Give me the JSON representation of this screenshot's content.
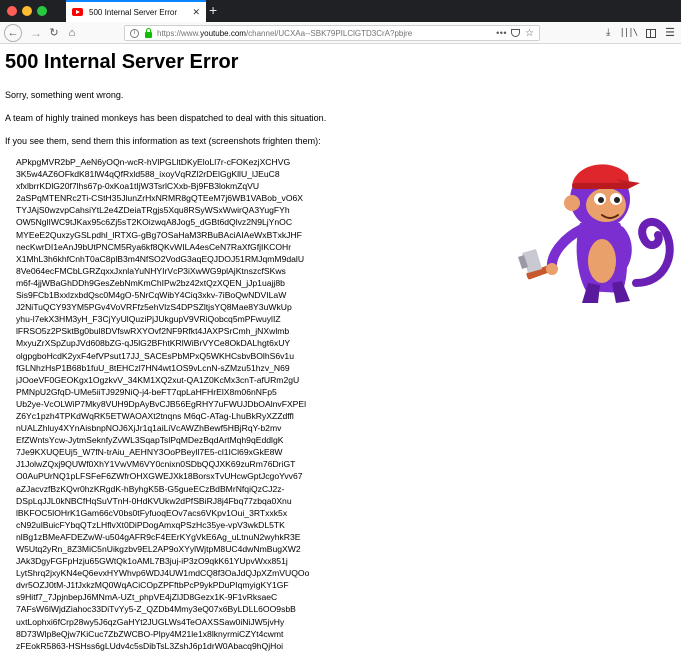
{
  "browser": {
    "tab_title": "500 Internal Server Error",
    "tab_close": "✕",
    "new_tab": "+",
    "url_prefix": "https://www.",
    "url_host": "youtube.com",
    "url_path": "/channel/UCXAa--SBK79PILClGTD3CrA?pbjre",
    "url_more": "•••",
    "icons": {
      "back": "back-arrow-icon",
      "forward": "forward-arrow-icon",
      "reload": "reload-icon",
      "home": "home-icon",
      "info": "info-icon",
      "lock": "lock-icon",
      "pocket": "pocket-icon",
      "star": "bookmark-star-icon",
      "download": "download-icon",
      "library": "library-icon",
      "sidebar": "sidebar-icon",
      "menu": "hamburger-menu-icon"
    },
    "colors": {
      "accent": "#0a84ff",
      "lock": "#12bc00",
      "favicon": "#ff0000"
    }
  },
  "page": {
    "title": "500 Internal Server Error",
    "message_1": "Sorry, something went wrong.",
    "message_2": "A team of highly trained monkeys has been dispatched to deal with this situation.",
    "message_3": "If you see them, send them this information as text (screenshots frighten them):",
    "image": "monkey-with-hammer-illustration",
    "code_lines": [
      "APkpgMVR2bP_AeN6yOQn-wcR-hVlPGLltDKyEloLl7r-cFOKezjXCHVG",
      "3K5w4AZ6OFkdK81lW4qQfRxld588_ixoyVqRZl2rDElGgKllU_lJEuC8",
      "xfxlbrrKDlG20f7lhs67p-0xKoa1tIjW3TsrlCXxb-Bj9FB3lokmZqVU",
      "2aSPqMTENRc2Ti-CStH35JlunZrHxNRMR8gQTEeM7j6WB1VABob_vO6X",
      "TYJAjS0wzvpCahsiYtL2e4ZDeiaTRgjs5Xqu8RSyWSxWwirQA3YugFYh",
      "OW5NglIWC9tJKax95c6Zj5sT2KOizwqA8Jog5_dGBt6dQlvz2N9LjYnOC",
      "MYEeE2QuxzyGSLpdhl_lRTXG-gBg7OSaHaM3RBuBAciAIAeWxBTxkJHF",
      "necKwrDI1eAnJ9bUtPNCM5Rya6kf8QKvWILA4esCeN7RaXfGfjIKCOHr",
      "X1MhL3h6khfCnhT0aC8plB3m4NfSO2VodG3aqEQJDOJ51RMJqmM9dalU",
      "8Ve064ecFMCbLGRZqxxJxnlaYuNHYIrVcP3iXwWG9plAjKtnszcfSKws",
      "m6f-4jjWBaGhDDh9GesZebNmKmChIPw2bz42xtQzXQEN_jJp1uajj8b",
      "Sis9FCb1BxxlzxbdQsc0M4gO-5NrCqWibY4Ciq3xkv-7iBoQwNDVILaW",
      "J2NiTuQCY93YM5PGv4VoVRFfz5ehVlzS4DPSZltjsYQ8Mae8Y3uWkUp",
      "yhu-l7ekX3HM3yH_F3CjYyUlQuziPjJUkgupV9VRiQobcq5mPFwuylIZ",
      "lFRSO5z2PSktBg0bul8DVfswRXYOvf2NF9Rfkt4JAXPSrCmh_jNXwlmb",
      "MxyuZrXSpZupJVd608bZG-qJ5lG2BFhtKRlWiBrVYCe8OkDALhgt6xUY",
      "olgpgboHcdK2yxF4efVPsut17JJ_SACEsPbMPxQ5WKHCsbvBOlhS6v1u",
      "fGLNhzHsP1B68b1fuU_8tEHCzl7HN4wt1OS9vLcnN-sZMzu51hzv_N69",
      "jJOoeVF0GEOKgx1OgzkvV_34KM1XQ2xut-QA1Z0KcMx3cnT-afURm2gU",
      "PMNpU2GfqD-UMe5iiTJ929NiQ-j4-beFT7qpLaHFHrElX8m06nNFp5",
      "Ub2ye-VcOLWiP7Mky8VUH9DpAyBvCJB56EgRHY7uFWUJDbOAlnvFXPEl",
      "Z6Yc1pzh4TPKdWqRK5ETWAOAXt2tnqns M6qC-ATag-LhuBkRyXZZdffl",
      "nUALZhluy4XYnAisbnpNOJ6XjJr1q1aiLiVcAWZhBewf5HBjRqY-b2mv",
      "EfZWntsYcw-JytmSeknfyZvWL3SqapTslPqMDezBqdArtMqh9qEddlgK",
      "7Je9KXUQEUj5_W7fN-trAiu_AEHNY3OoPBeyll7E5-cl1ICl69xGkE8W",
      "J1JolwZQxj9QUWf0XhY1VwVM6VY0cnixn0SDbQQJXK69zuRm76DriGT",
      "O0AuPUrNQ1pLFSFeF6ZWfrOHXGWEJXk18BorsxTvUHcwGptJcgoYvv67",
      "aZJacvzfBzKQvr0hzKRgdK-hByhgK5B-G5gueECzBdBMrNfqiQzCJ2z-",
      "DSpLqJJL0kNBCfHqSuVTnH-0HdKVUkw2dPfSBiRJ8j4Fbq77zbqa0Xnu",
      "lBKFOC5lOHrK1Gam66cV0bs0tFyfuoqEOv7acs6VKpv1Oui_3RTxxk5x",
      "cN92ulBuicFYbqQTzLHflvXt0DiPDogAmxqPSzHc35ye-vpV3wkDL5TK",
      "nlBg1zBMeAFDEZwW-u504gAFR9cF4EErKYgVkE6Ag_uLtnuN2wyhkR3E",
      "W5Utq2yRn_8Z3MiC5nUikgzbv9EL2AP9oXYylWjtpM8UC4dwNmBugXW2",
      "JAk3DgyFGFpHzju65GWtQk1oAML7B3juj-iP3zO9qkK61YUpvWxx851j",
      "LytShrq2jxyKN4eQ6evxHYWhvp6WDJ4UW1mdCQ8f3OaJdQJpXZmVUQOo",
      "dvr5OZJ0tM-J1fJxkzMQ0WqACiCOpZPFftbPcP9ykPDuPIqmyigKY1GF",
      "s9Hitf7_7JpjnbepJ6MNmA-UZt_phpVE4jZlJD8Gezx1K-9F1vRksaeC",
      "7AFsW6lWjdZiahoc33DiTvYy5-Z_QZDb4Mmy3eQ07x6ByLDLL6OO9sbB",
      "uxtLophxi6fCrp28wy5J6qzGaHYt2JUGLWs4TeOAXSSaw0iNiJW5jvHy",
      "8D73Wlp8eQjw7KiCuc7ZbZWCBO-Plpy4M21le1x8lknyrmiCZYt4cwmt",
      "zFEokR5863-HSHss6gLUdv4c5sDibTsL3ZshJ6p1drW0Abacq9hQjHoi"
    ]
  }
}
